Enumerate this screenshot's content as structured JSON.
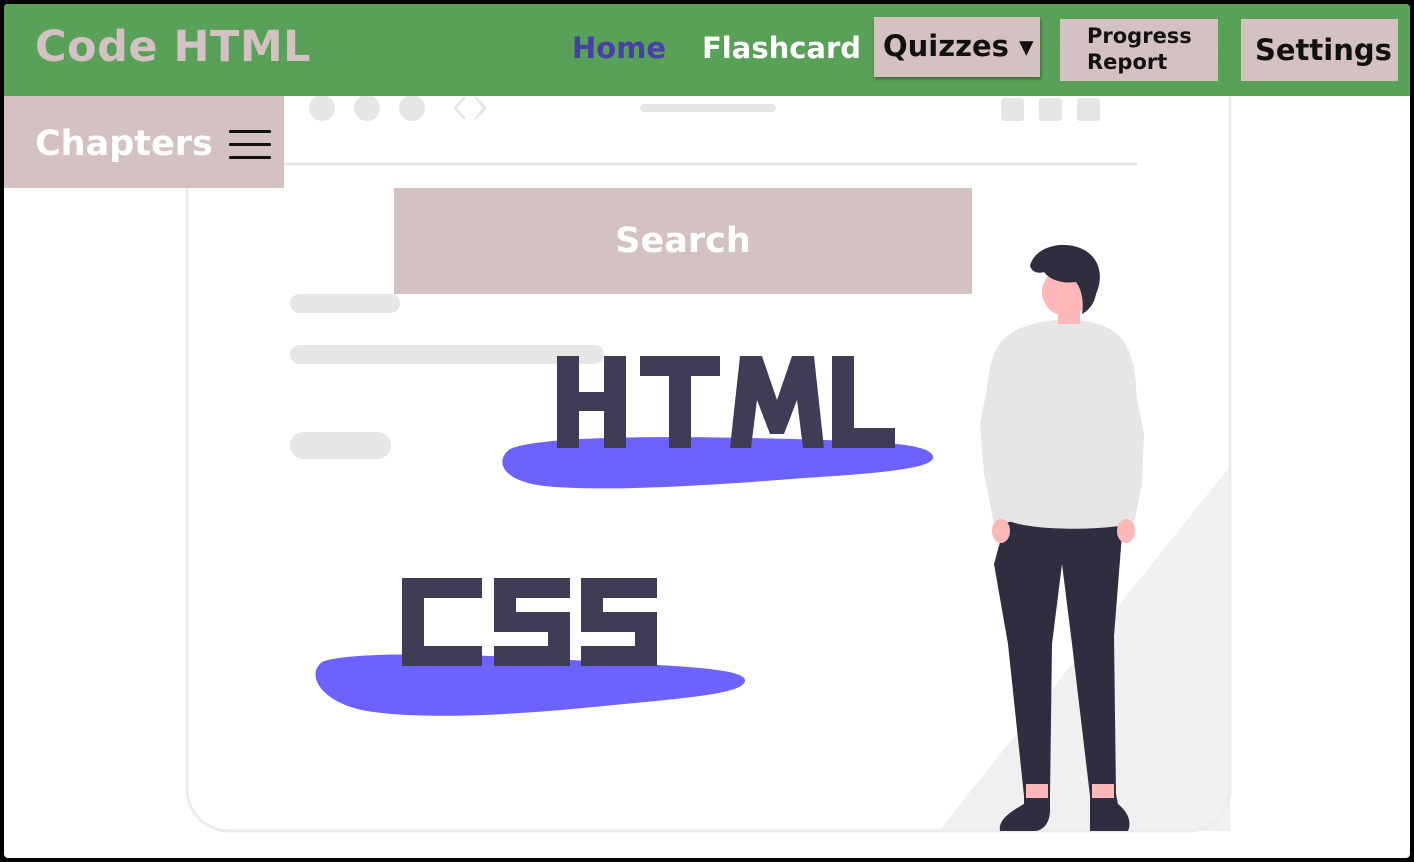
{
  "header": {
    "brand": "Code HTML",
    "nav": {
      "home": "Home",
      "flashcard": "Flashcard",
      "quizzes": "Quizzes ▾",
      "progress_line1": "Progress",
      "progress_line2": "Report",
      "settings": "Settings"
    }
  },
  "sidebar": {
    "chapters_label": "Chapters",
    "menu_icon": "hamburger-menu-icon"
  },
  "search": {
    "placeholder": "Search"
  },
  "hero_illustration": {
    "labels": [
      "HTML",
      "CSS"
    ],
    "icons": [
      "browser-dots-icon",
      "code-brackets-icon",
      "person-illustration"
    ]
  },
  "colors": {
    "header_bg": "#4c994c",
    "button_bg": "#d4c2c2",
    "home_link": "#4a3ea8",
    "accent_blob": "#6c63ff",
    "dark_text": "#3f3d56",
    "figure_dark": "#2f2e41",
    "skin": "#ffb8b8",
    "shirt": "#e6e6e6"
  }
}
